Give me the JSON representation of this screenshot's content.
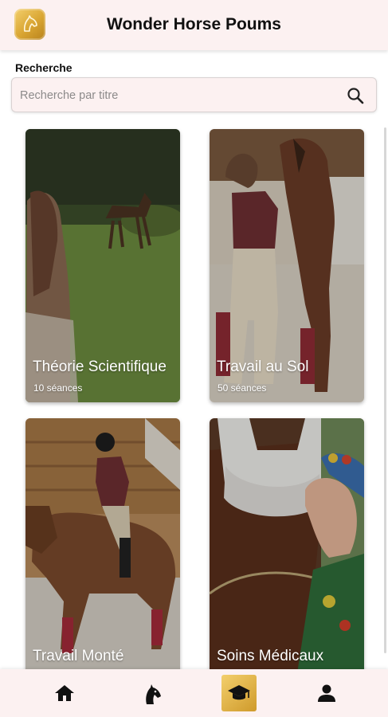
{
  "header": {
    "title": "Wonder Horse Poums",
    "logo_icon": "horse-head-logo-icon",
    "background": "#fcf1f1"
  },
  "search": {
    "label": "Recherche",
    "placeholder": "Recherche par titre",
    "value": "",
    "icon": "search-icon"
  },
  "cards": [
    {
      "title": "Théorie Scientifique",
      "count": "10 séances"
    },
    {
      "title": "Travail au Sol",
      "count": "50 séances"
    },
    {
      "title": "Travail Monté",
      "count": ""
    },
    {
      "title": "Soins Médicaux",
      "count": ""
    }
  ],
  "bottom_nav": {
    "items": [
      {
        "icon": "home-icon",
        "active": false
      },
      {
        "icon": "horse-head-icon",
        "active": false
      },
      {
        "icon": "graduation-cap-icon",
        "active": true
      },
      {
        "icon": "person-icon",
        "active": false
      }
    ],
    "active_color": "#e2b04a"
  }
}
